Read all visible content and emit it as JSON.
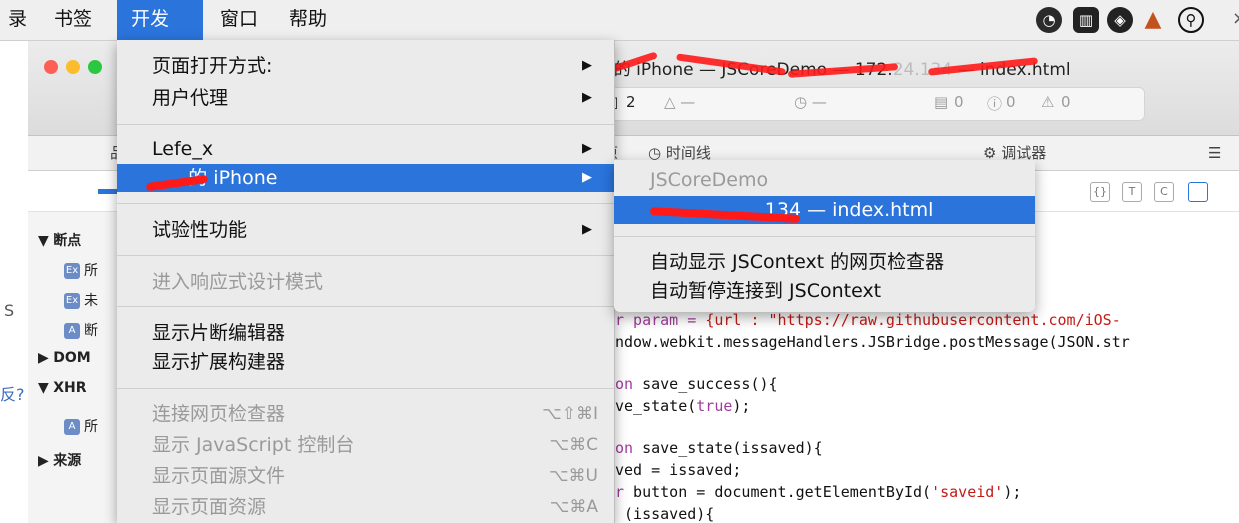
{
  "menubar": {
    "items": [
      "录",
      "书签",
      "开发",
      "窗口",
      "帮助"
    ],
    "active_index": 2,
    "tray_icons": [
      "wechat-icon",
      "app-icon",
      "shield-icon",
      "lantern-icon",
      "search-icon"
    ],
    "tray_overflow": "×"
  },
  "window": {
    "title_suffix": "— index.html",
    "title_prefix": "的 iPhone — JSCoreDemo — 172.",
    "status": {
      "files": "2",
      "errors": "0",
      "warnings": "0"
    },
    "tabs": {
      "timeline": "时间线",
      "debugger": "调试器"
    },
    "toolbar_buttons": [
      "{}",
      "T",
      "C"
    ]
  },
  "sidebar": {
    "rows": [
      {
        "label": "断点",
        "type": "header",
        "expanded": true
      },
      {
        "label": "所",
        "badge": "Ex",
        "badge_color": "#6b8cc7"
      },
      {
        "label": "未",
        "badge": "Ex",
        "badge_color": "#6b8cc7"
      },
      {
        "label": "断",
        "badge": "A",
        "badge_color": "#6b8cc7"
      },
      {
        "label": "DOM",
        "type": "header",
        "expanded": false
      },
      {
        "label": "XHR",
        "type": "header",
        "expanded": true
      },
      {
        "label": "所",
        "badge": "A",
        "badge_color": "#6b8cc7"
      },
      {
        "label": "来源",
        "type": "header",
        "expanded": false
      }
    ],
    "edge_text": [
      "S",
      "反?"
    ]
  },
  "code_lines": [
    {
      "pre": "r param = ",
      "str": "{url : \"https://raw.githubusercontent.com/iOS-",
      "post": ""
    },
    {
      "pre": "ndow.webkit.messageHandlers.JSBridge.postMessage(JSON.str",
      "str": "",
      "post": ""
    },
    {
      "pre": "",
      "str": "",
      "post": ""
    },
    {
      "pre": "on save_success(){",
      "str": "",
      "post": ""
    },
    {
      "pre": "ve_state(",
      "kw": "true",
      "post": ");"
    },
    {
      "pre": "",
      "str": "",
      "post": ""
    },
    {
      "pre": "on save_state(issaved){",
      "str": "",
      "post": ""
    },
    {
      "pre": "ved = issaved;",
      "str": "",
      "post": ""
    },
    {
      "pre": "r button = document.getElementById(",
      "str": "'saveid'",
      "post": ");"
    },
    {
      "pre": " (issaved){",
      "str": "",
      "post": ""
    }
  ],
  "dev_menu": {
    "items": [
      {
        "label": "页面打开方式:",
        "submenu": true
      },
      {
        "label": "用户代理",
        "submenu": true
      },
      {
        "label": "Lefe_x",
        "submenu": true
      },
      {
        "label": "的 iPhone",
        "submenu": true,
        "highlighted": true
      },
      {
        "label": "试验性功能",
        "submenu": true
      },
      {
        "label": "进入响应式设计模式",
        "disabled": true
      },
      {
        "label": "显示片断编辑器"
      },
      {
        "label": "显示扩展构建器"
      },
      {
        "label": "连接网页检查器",
        "shortcut": "⌥⇧⌘I",
        "disabled": true
      },
      {
        "label": "显示 JavaScript 控制台",
        "shortcut": "⌥⌘C",
        "disabled": true
      },
      {
        "label": "显示页面源文件",
        "shortcut": "⌥⌘U",
        "disabled": true
      },
      {
        "label": "显示页面资源",
        "shortcut": "⌥⌘A",
        "disabled": true
      }
    ]
  },
  "device_submenu": {
    "header": "JSCoreDemo",
    "highlighted": "134 — index.html",
    "options": [
      "自动显示 JSContext 的网页检查器",
      "自动暂停连接到 JSContext"
    ]
  }
}
